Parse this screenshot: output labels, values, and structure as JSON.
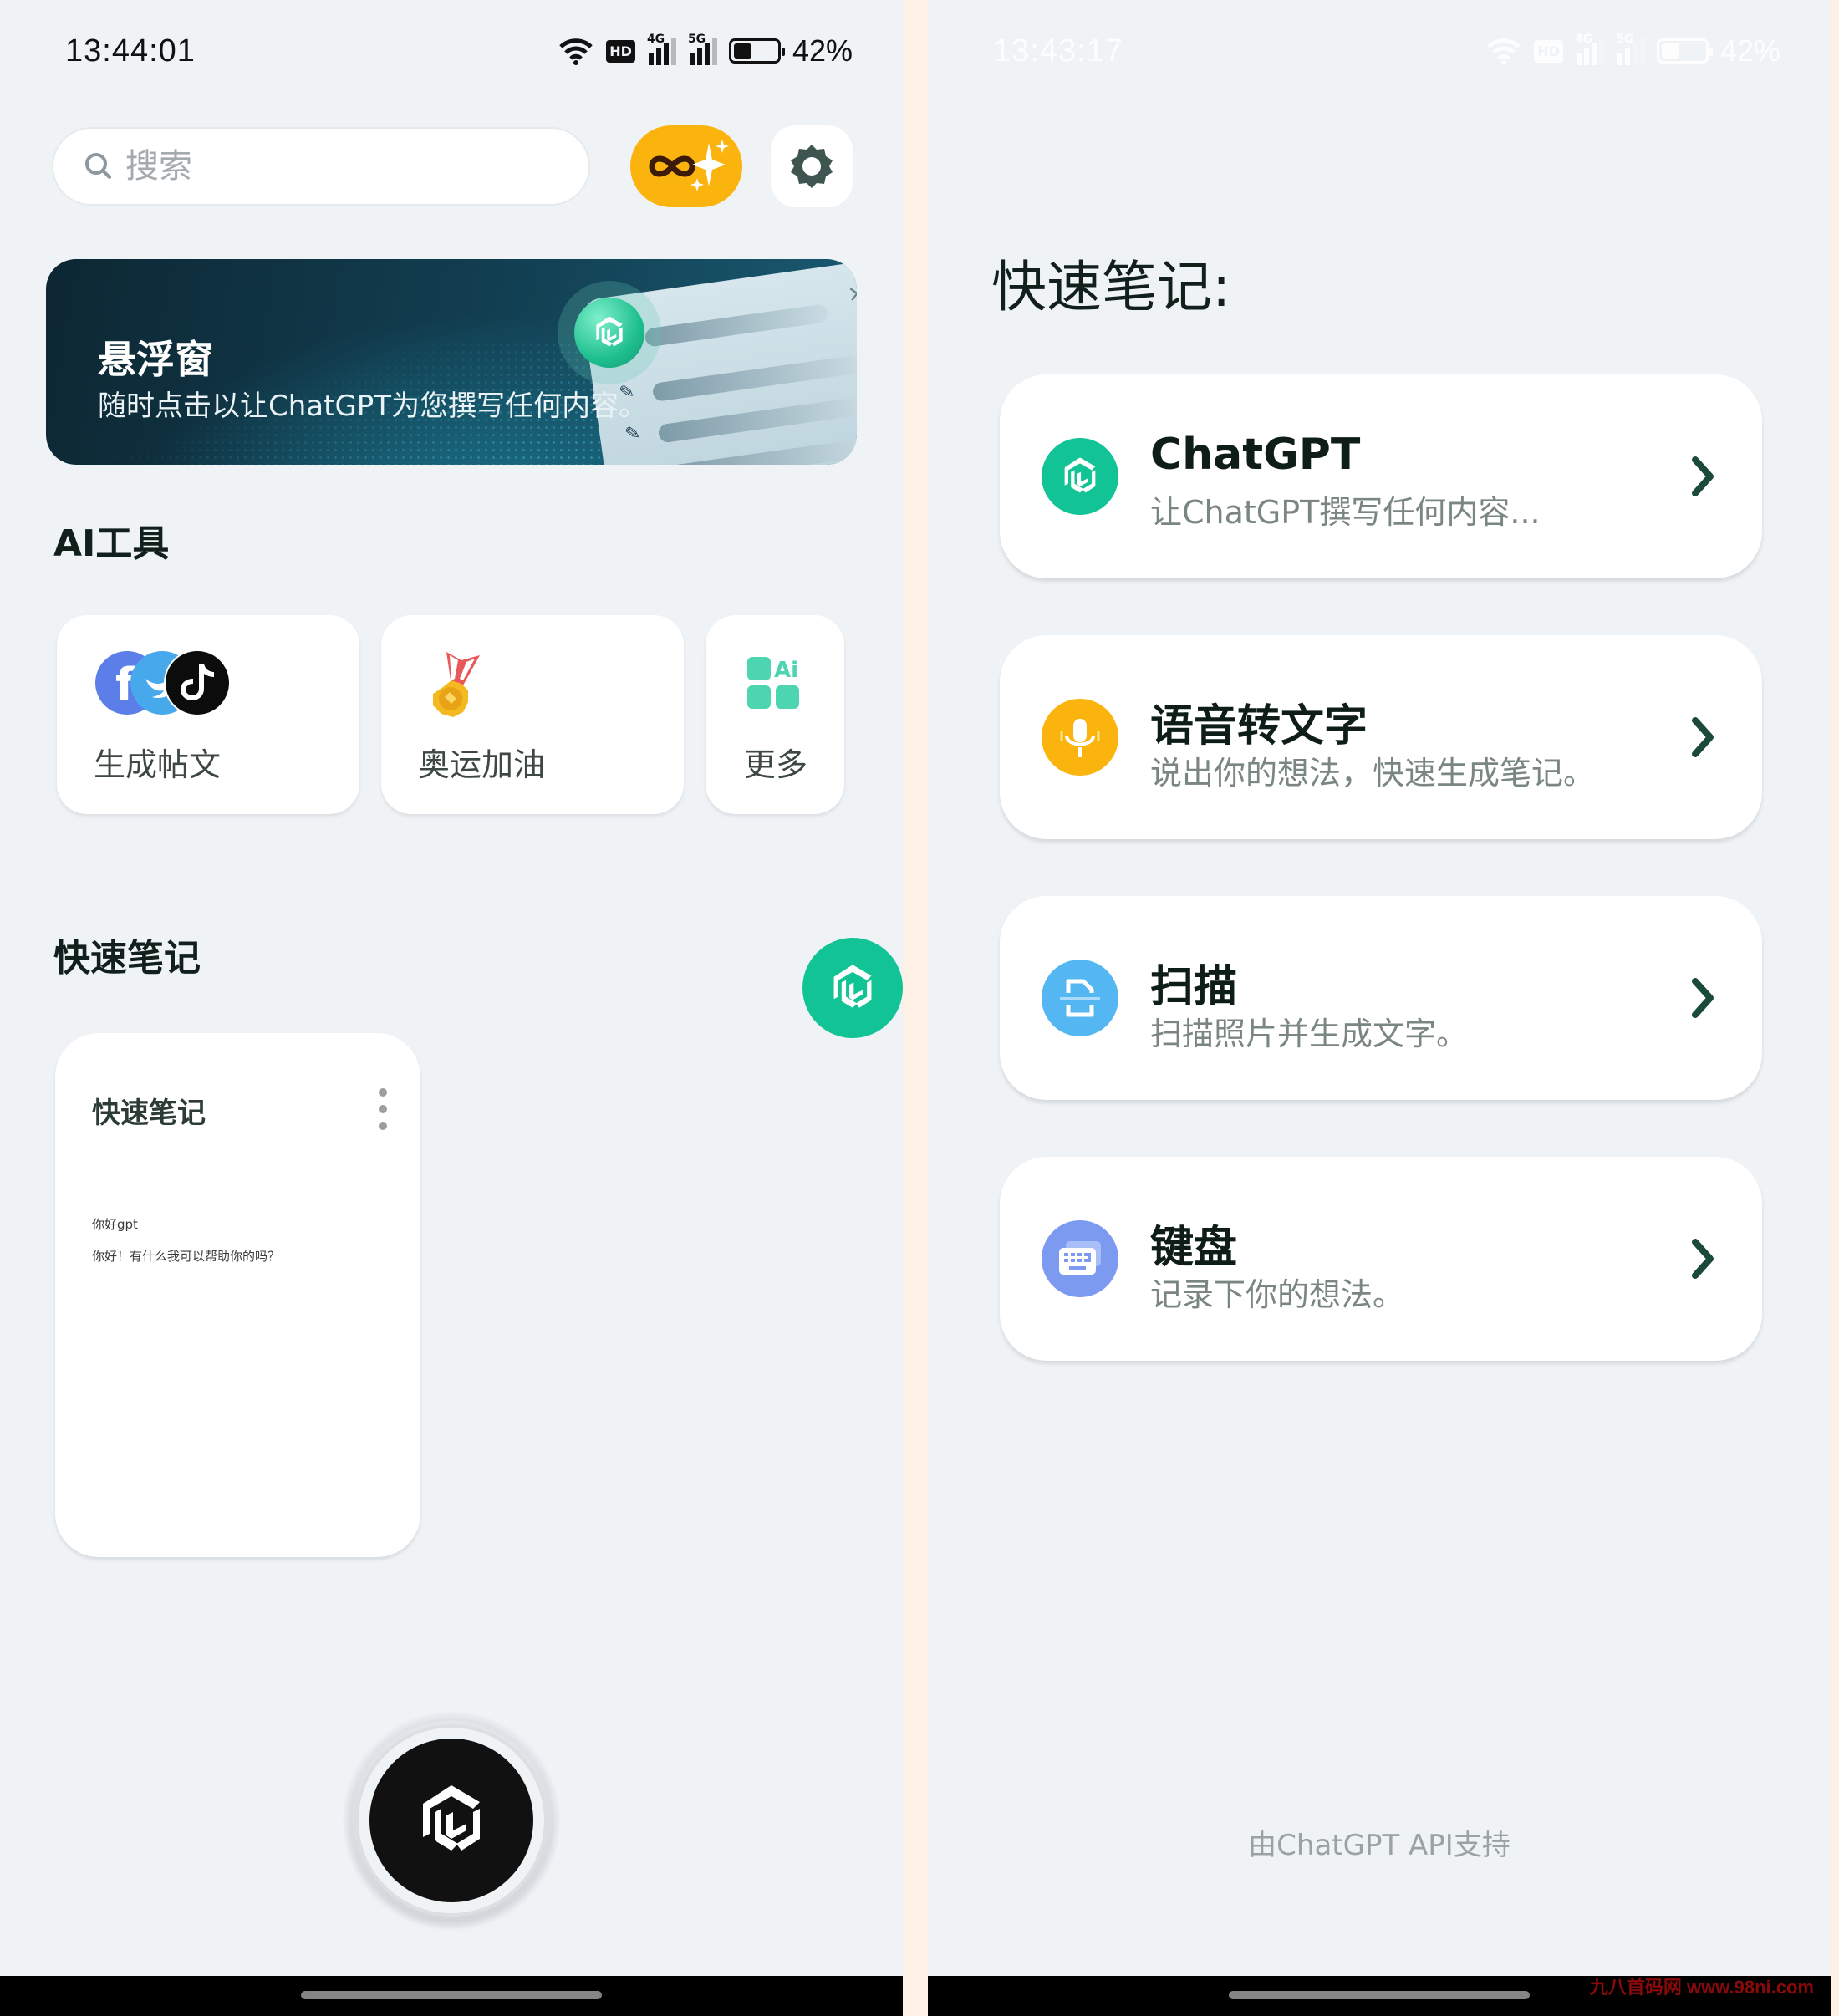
{
  "left_screen": {
    "status_bar": {
      "time": "13:44:01",
      "battery_percent": "42%",
      "battery_level": 0.42,
      "network_labels": [
        "4G",
        "5G"
      ],
      "hd_label": "HD",
      "icons": [
        "wifi-icon",
        "hd-voice-icon",
        "signal-4g-icon",
        "signal-5g-icon",
        "battery-icon"
      ]
    },
    "search": {
      "placeholder": "搜索",
      "value": ""
    },
    "top_buttons": {
      "pro": "infinity-sparkle-icon",
      "settings": "gear-icon"
    },
    "banner": {
      "title": "悬浮窗",
      "subtitle": "随时点击以让ChatGPT为您撰写任何内容。",
      "close_glyph": "×"
    },
    "ai_tools": {
      "title": "AI工具",
      "items": [
        {
          "label": "生成帖文",
          "icon": "social-media-icons"
        },
        {
          "label": "奥运加油",
          "icon": "medal-icon"
        },
        {
          "label": "更多",
          "icon": "ai-apps-grid-icon"
        }
      ]
    },
    "quick_notes": {
      "title": "快速笔记",
      "cards": [
        {
          "title": "快速笔记",
          "line1": "你好gpt",
          "line2": "你好！有什么我可以帮助你的吗？"
        }
      ]
    }
  },
  "right_screen": {
    "status_bar": {
      "time": "13:43:17",
      "battery_percent": "42%",
      "battery_level": 0.42,
      "network_labels": [
        "4G",
        "5G"
      ],
      "hd_label": "HD"
    },
    "title": "快速笔记:",
    "features": [
      {
        "title": "ChatGPT",
        "description": "让ChatGPT撰写任何内容...",
        "icon": "chatgpt-logo-icon",
        "color": "#12c495"
      },
      {
        "title": "语音转文字",
        "description": "说出你的想法，快速生成笔记。",
        "icon": "microphone-icon",
        "color": "#fbb40d"
      },
      {
        "title": "扫描",
        "description": "扫描照片并生成文字。",
        "icon": "scan-document-icon",
        "color": "#55b7f1"
      },
      {
        "title": "键盘",
        "description": "记录下你的想法。",
        "icon": "keyboard-icon",
        "color": "#7c9af0"
      }
    ],
    "footer": "由ChatGPT API支持",
    "watermark": "九八首码网 www.98ni.com"
  },
  "colors": {
    "background": "#eff3f6",
    "accent_green": "#12c495",
    "accent_yellow": "#fbb40d",
    "divider": "#fdf0e4",
    "chevron": "#1c4a3a"
  }
}
